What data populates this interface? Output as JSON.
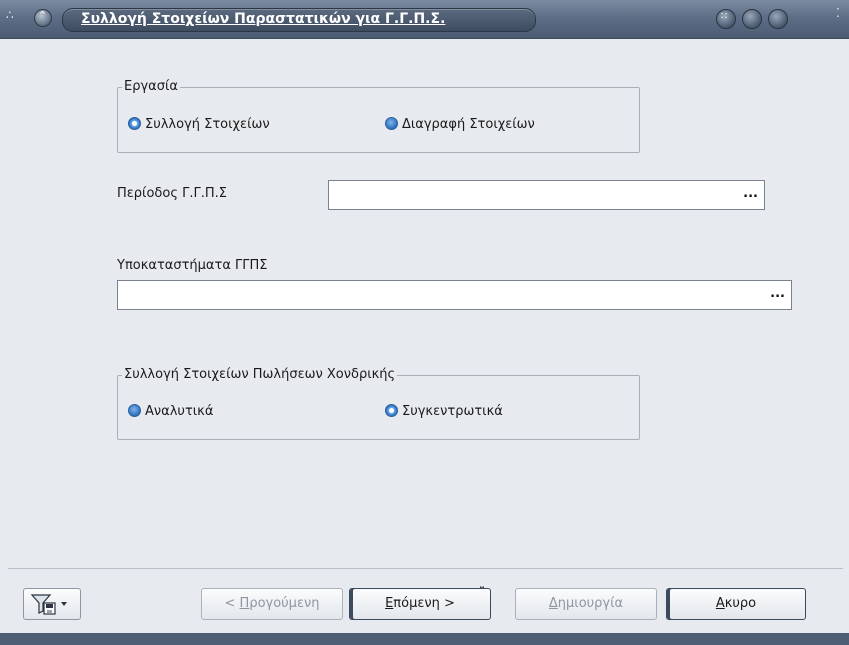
{
  "window": {
    "title": "Συλλογή Στοιχείων Παραστατικών για Γ.Γ.Π.Σ."
  },
  "task_group": {
    "legend": "Εργασία",
    "options": [
      {
        "label": "Συλλογή Στοιχείων",
        "checked": true
      },
      {
        "label": "Διαγραφή Στοιχείων",
        "checked": false
      }
    ]
  },
  "period": {
    "label": "Περίοδος Γ.Γ.Π.Σ",
    "value": "",
    "button": "..."
  },
  "branches": {
    "label": "Υποκαταστήματα ΓΓΠΣ",
    "value": "",
    "button": "..."
  },
  "wholesale_group": {
    "legend": "Συλλογή Στοιχείων Πωλήσεων Χονδρικής",
    "options": [
      {
        "label": "Αναλυτικά",
        "checked": false
      },
      {
        "label": "Συγκεντρωτικά",
        "checked": true
      }
    ]
  },
  "buttons": {
    "previous": {
      "prefix": "< ",
      "accel": "Π",
      "rest": "ρογούμενη"
    },
    "next": {
      "accel": "Ε",
      "rest": "πόμενη >"
    },
    "create": {
      "accel": "Δ",
      "rest": "ημιουργία"
    },
    "cancel": {
      "accel": "Α",
      "rest": "κυρο"
    }
  },
  "icons": {
    "filter": "filter-save-icon",
    "dropdown": "chevron-down-icon"
  }
}
